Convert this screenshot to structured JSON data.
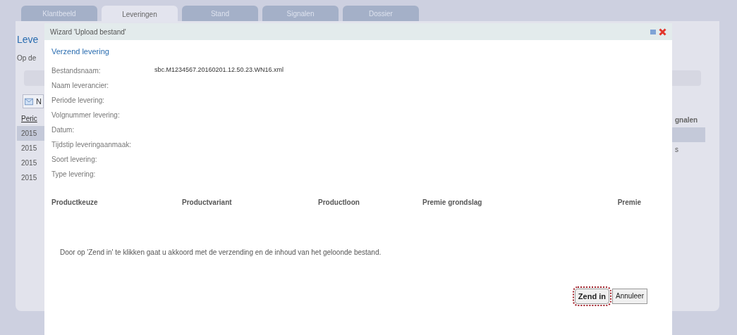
{
  "tabs": [
    {
      "label": "Klantbeeld",
      "selected": false
    },
    {
      "label": "Leveringen",
      "selected": true
    },
    {
      "label": "Stand",
      "selected": false
    },
    {
      "label": "Signalen",
      "selected": false
    },
    {
      "label": "Dossier",
      "selected": false
    }
  ],
  "page": {
    "heading": "Leve",
    "intro": "Op de",
    "new_button": "N",
    "columns": [
      "Peric",
      "gnalen"
    ],
    "rows": [
      {
        "period": "2015",
        "selected": true
      },
      {
        "period": "2015",
        "column_2": "s",
        "selected": false
      },
      {
        "period": "2015",
        "selected": false
      },
      {
        "period": "2015",
        "selected": false
      }
    ]
  },
  "dialog": {
    "title": "Wizard 'Upload bestand'",
    "step": "Verzend levering",
    "fields": [
      {
        "label": "Bestandsnaam:",
        "value": "sbc.M1234567.20160201.12.50.23.WN16.xml"
      },
      {
        "label": "Naam leverancier:"
      },
      {
        "label": "Periode levering:"
      },
      {
        "label": "Volgnummer levering:"
      },
      {
        "label": "Datum:"
      },
      {
        "label": "Tijdstip leveringaanmaak:"
      },
      {
        "label": "Soort levering:"
      },
      {
        "label": "Type levering:"
      }
    ],
    "columns": [
      "Productkeuze",
      "Productvariant",
      "Productloon",
      "Premie grondslag",
      "Premie"
    ],
    "notice": "Door op 'Zend in' te klikken gaat u akkoord met de verzending en de inhoud van het geloonde bestand.",
    "buttons": [
      {
        "label": "Zend in",
        "focused": true
      },
      {
        "label": "Annuleer",
        "focused": false
      }
    ]
  }
}
